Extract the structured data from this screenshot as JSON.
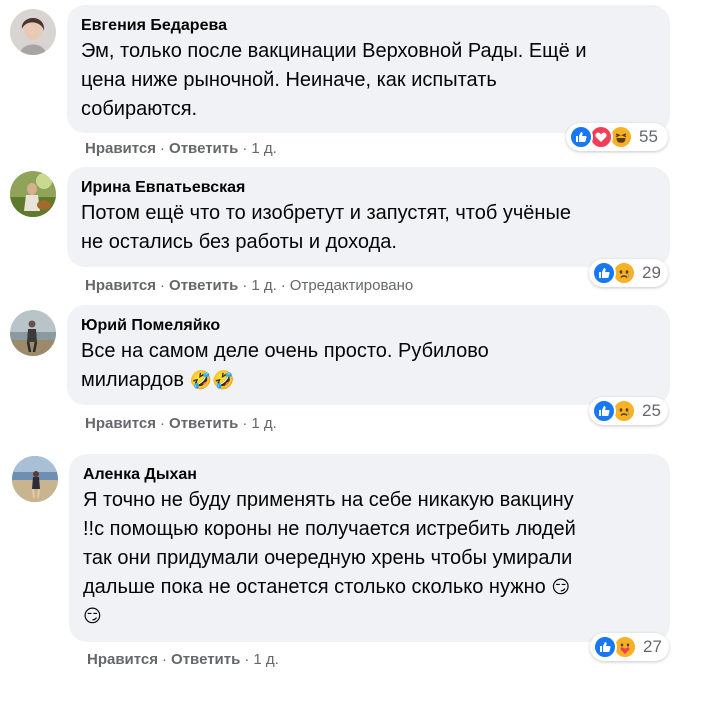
{
  "comments": [
    {
      "author": "Евгения Бедарева",
      "lines": [
        "Эм, только после вакцинации Верховной Рады. Ещё и",
        "цена ниже рыночной. Неиначе, как испытать",
        "собираются."
      ],
      "reactions": [
        "like-icon",
        "love-icon",
        "haha-icon"
      ],
      "reaction_count": "55",
      "like_label": "Нравится",
      "reply_label": "Ответить",
      "time": "1 д.",
      "edited": ""
    },
    {
      "author": "Ирина Евпатьевская",
      "lines": [
        "Потом ещё что то изобретут и запустят, чтоб учёные",
        "не остались без работы и дохода."
      ],
      "reactions": [
        "like-icon",
        "sad-icon"
      ],
      "reaction_count": "29",
      "like_label": "Нравится",
      "reply_label": "Ответить",
      "time": "1 д.",
      "edited": "Отредактировано"
    },
    {
      "author": "Юрий Помеляйко",
      "lines": [
        "Все на самом деле очень просто. Рубилово",
        "милиардов"
      ],
      "line_emoji": "🤣🤣",
      "reactions": [
        "like-icon",
        "sad-icon"
      ],
      "reaction_count": "25",
      "like_label": "Нравится",
      "reply_label": "Ответить",
      "time": "1 д.",
      "edited": ""
    },
    {
      "author": "Аленка Дыхан",
      "lines": [
        "Я точно не буду применять на себе никакую вакцину",
        "!!с помощью короны не получается истребить людей",
        "так они придумали очередную хрень чтобы умирали",
        "дальше пока не останется столько сколько нужно"
      ],
      "line_emoji": "😏",
      "trailing_emoji": "😏",
      "reactions": [
        "like-icon",
        "care-icon"
      ],
      "reaction_count": "27",
      "like_label": "Нравится",
      "reply_label": "Ответить",
      "time": "1 д.",
      "edited": ""
    }
  ],
  "colors": {
    "bubble": "#f0f2f5",
    "meta_text": "#65676b",
    "like_blue": "#1877f2",
    "love_red": "#f33e58",
    "emoji_yellow": "#f7b125"
  }
}
